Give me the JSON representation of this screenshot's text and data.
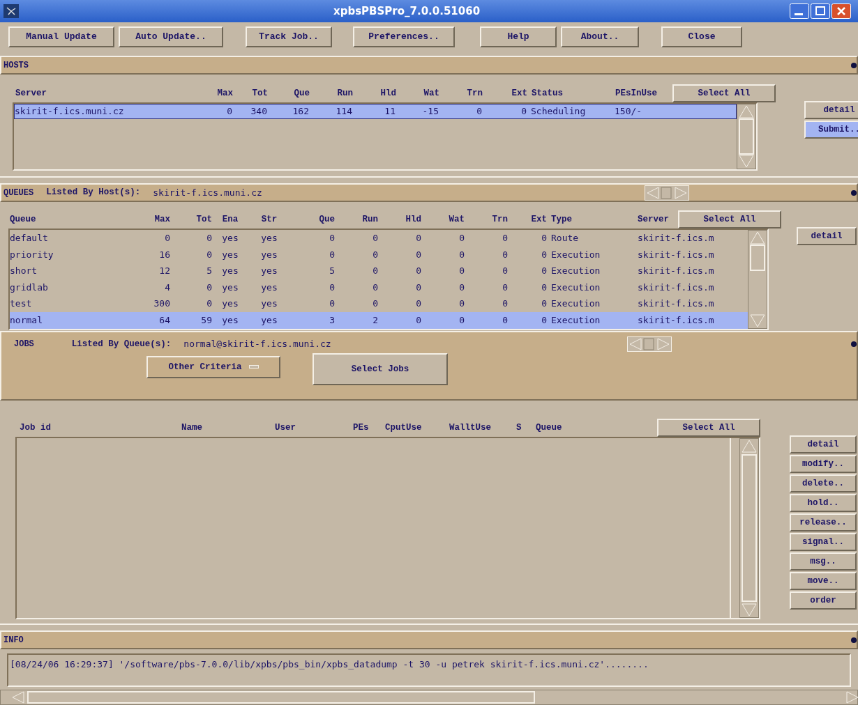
{
  "window": {
    "title": "xpbsPBSPro_7.0.0.51060"
  },
  "menu": [
    "Manual Update",
    "Auto Update..",
    "Track Job..",
    "Preferences..",
    "Help",
    "About..",
    "Close"
  ],
  "hosts": {
    "title": "HOSTS",
    "columns": [
      "Server",
      "Max",
      "Tot",
      "Que",
      "Run",
      "Hld",
      "Wat",
      "Trn",
      "Ext",
      "Status",
      "PEsInUse"
    ],
    "select_all": "Select All",
    "rows": [
      {
        "cells": [
          "skirit-f.ics.muni.cz",
          "0",
          "340",
          "162",
          "114",
          "11",
          "-15",
          "0",
          "0",
          "Scheduling",
          "150/-"
        ],
        "selected": true
      }
    ],
    "buttons": [
      {
        "label": "detail",
        "selected": false
      },
      {
        "label": "Submit..",
        "selected": true
      }
    ]
  },
  "queues": {
    "title": "QUEUES",
    "listed_by_label": "Listed By Host(s):",
    "listed_by_value": "skirit-f.ics.muni.cz",
    "columns": [
      "Queue",
      "Max",
      "Tot",
      "Ena",
      "Str",
      "Que",
      "Run",
      "Hld",
      "Wat",
      "Trn",
      "Ext",
      "Type",
      "Server"
    ],
    "select_all": "Select All",
    "rows": [
      {
        "cells": [
          "default",
          "0",
          "0",
          "yes",
          "yes",
          "0",
          "0",
          "0",
          "0",
          "0",
          "0",
          "Route",
          "skirit-f.ics.m"
        ],
        "selected": false
      },
      {
        "cells": [
          "priority",
          "16",
          "0",
          "yes",
          "yes",
          "0",
          "0",
          "0",
          "0",
          "0",
          "0",
          "Execution",
          "skirit-f.ics.m"
        ],
        "selected": false
      },
      {
        "cells": [
          "short",
          "12",
          "5",
          "yes",
          "yes",
          "5",
          "0",
          "0",
          "0",
          "0",
          "0",
          "Execution",
          "skirit-f.ics.m"
        ],
        "selected": false
      },
      {
        "cells": [
          "gridlab",
          "4",
          "0",
          "yes",
          "yes",
          "0",
          "0",
          "0",
          "0",
          "0",
          "0",
          "Execution",
          "skirit-f.ics.m"
        ],
        "selected": false
      },
      {
        "cells": [
          "test",
          "300",
          "0",
          "yes",
          "yes",
          "0",
          "0",
          "0",
          "0",
          "0",
          "0",
          "Execution",
          "skirit-f.ics.m"
        ],
        "selected": false
      },
      {
        "cells": [
          "normal",
          "64",
          "59",
          "yes",
          "yes",
          "3",
          "2",
          "0",
          "0",
          "0",
          "0",
          "Execution",
          "skirit-f.ics.m"
        ],
        "selected": true
      }
    ],
    "buttons": [
      "detail"
    ]
  },
  "jobs": {
    "title": "JOBS",
    "listed_by_label": "Listed By Queue(s):",
    "listed_by_value": "normal@skirit-f.ics.muni.cz",
    "other_criteria": "Other Criteria",
    "select_jobs": "Select Jobs",
    "columns": [
      "Job id",
      "Name",
      "User",
      "PEs",
      "CputUse",
      "WalltUse",
      "S",
      "Queue"
    ],
    "select_all": "Select All",
    "buttons": [
      "detail",
      "modify..",
      "delete..",
      "hold..",
      "release..",
      "signal..",
      "msg..",
      "move..",
      "order"
    ]
  },
  "info": {
    "title": "INFO",
    "message": "[08/24/06 16:29:37] '/software/pbs-7.0.0/lib/xpbs/pbs_bin/xpbs_datadump -t 30 -u petrek  skirit-f.ics.muni.cz'........"
  }
}
